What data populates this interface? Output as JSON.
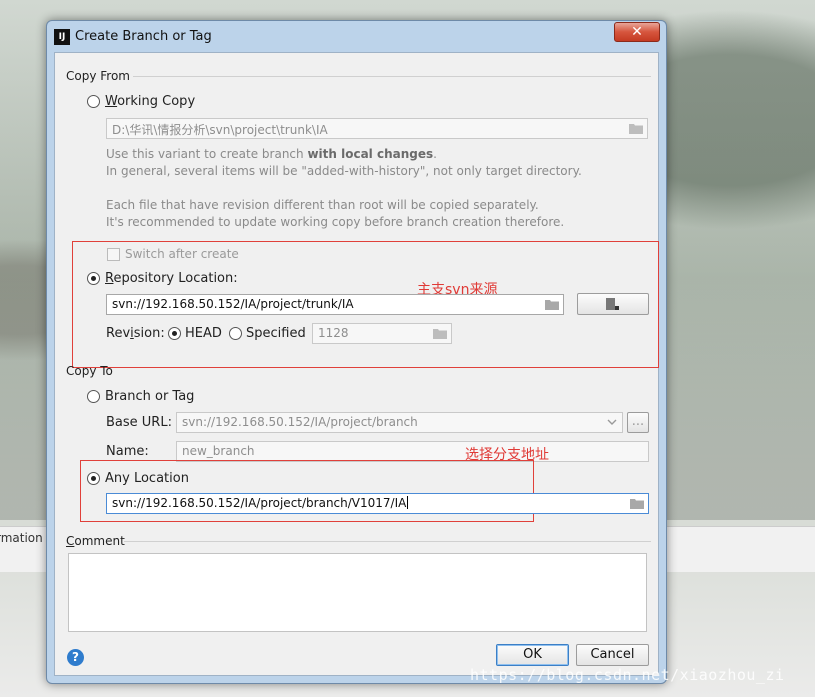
{
  "background": {
    "side_text": "rmation",
    "watermark": "https://blog.csdn.net/xiaozhou_zi"
  },
  "window": {
    "title": "Create Branch or Tag",
    "app_icon_text": "IJ",
    "close_glyph": "✕"
  },
  "copy_from": {
    "label": "Copy From",
    "working_copy": {
      "label": "Working Copy",
      "selected": false,
      "path": "D:\\华讯\\情报分析\\svn\\project\\trunk\\IA",
      "hint_1a": "Use this variant to create branch ",
      "hint_1b": "with local changes",
      "hint_1c": ".",
      "hint_2": "In general, several items will be \"added-with-history\", not only target directory.",
      "hint_3": "Each file that have revision different than root will be copied separately.",
      "hint_4": "It's recommended to update working copy before branch creation therefore."
    },
    "switch_after_create": {
      "label": "Switch after create",
      "checked": false
    },
    "repository_location": {
      "label": "Repository Location:",
      "selected": true,
      "url": "svn://192.168.50.152/IA/project/trunk/IA",
      "annotation": "主支svn来源"
    },
    "revision": {
      "label": "Revision:",
      "head_label": "HEAD",
      "head_selected": true,
      "specified_label": "Specified",
      "specified_selected": false,
      "specified_value": "1128"
    }
  },
  "copy_to": {
    "label": "Copy To",
    "branch_or_tag": {
      "label": "Branch or Tag",
      "selected": false,
      "base_url_label": "Base URL:",
      "base_url_value": "svn://192.168.50.152/IA/project/branch",
      "more_button": "...",
      "name_label": "Name:",
      "name_value": "new_branch"
    },
    "any_location": {
      "label": "Any Location",
      "selected": true,
      "url": "svn://192.168.50.152/IA/project/branch/V1017/IA",
      "annotation": "选择分支地址"
    }
  },
  "comment": {
    "label": "Comment",
    "value": ""
  },
  "buttons": {
    "ok": "OK",
    "cancel": "Cancel",
    "help": "?"
  },
  "colors": {
    "annotation_red": "#e03a36",
    "focus_blue": "#4a8bd6",
    "help_blue": "#2f7ccd"
  }
}
